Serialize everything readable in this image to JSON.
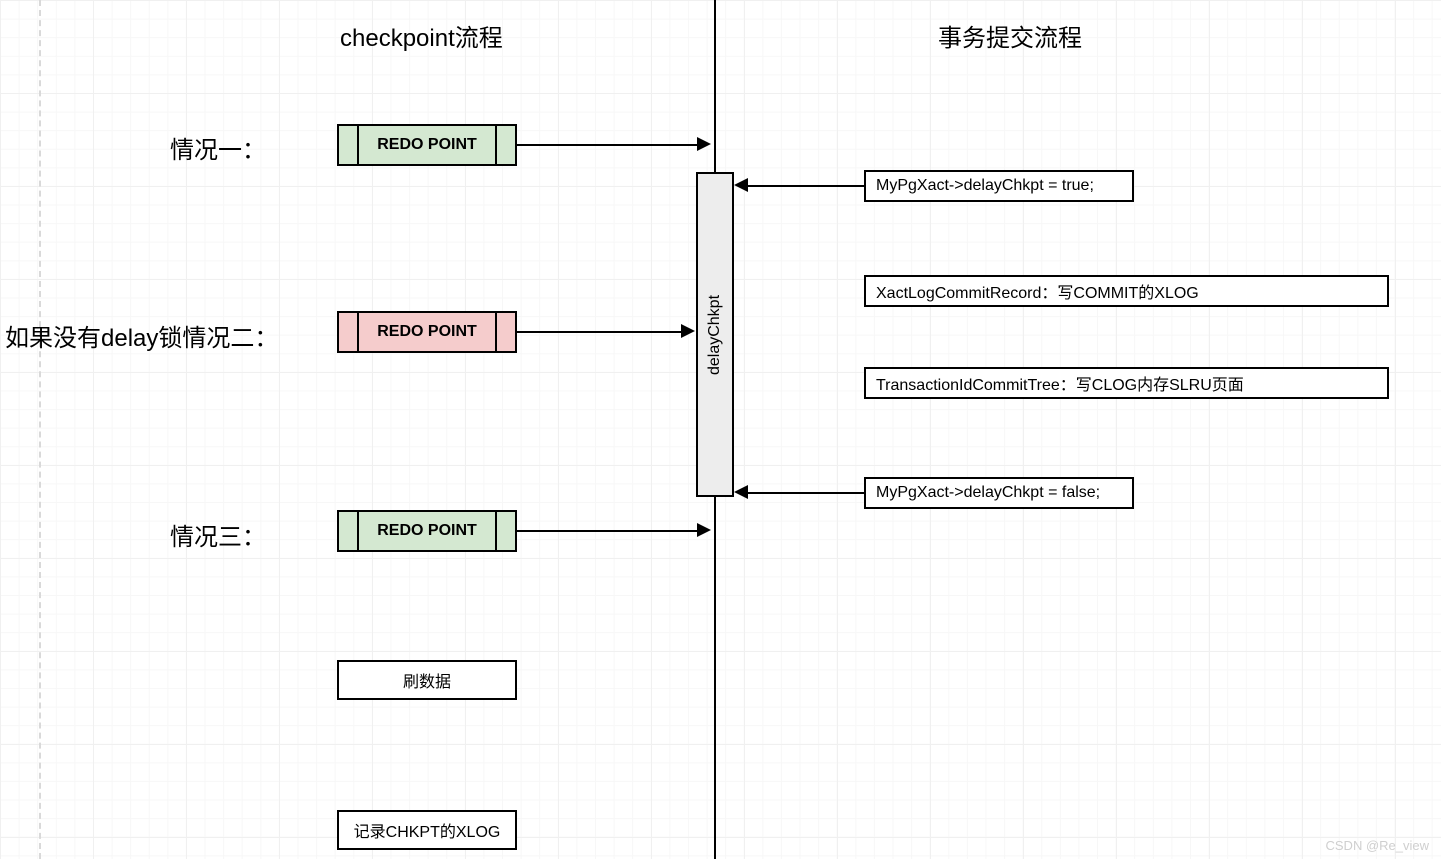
{
  "headers": {
    "left": "checkpoint流程",
    "right": "事务提交流程"
  },
  "cases": {
    "c1": "情况一：",
    "c2": "如果没有delay锁情况二：",
    "c3": "情况三："
  },
  "redo": "REDO POINT",
  "delay_label": "delayChkpt",
  "right_boxes": {
    "delay_true": "MyPgXact->delayChkpt = true;",
    "xlog": "XactLogCommitRecord：写COMMIT的XLOG",
    "clog": "TransactionIdCommitTree：写CLOG内存SLRU页面",
    "delay_false": "MyPgXact->delayChkpt = false;"
  },
  "bottom_boxes": {
    "flush": "刷数据",
    "record": "记录CHKPT的XLOG"
  },
  "watermark": "CSDN @Re_view"
}
